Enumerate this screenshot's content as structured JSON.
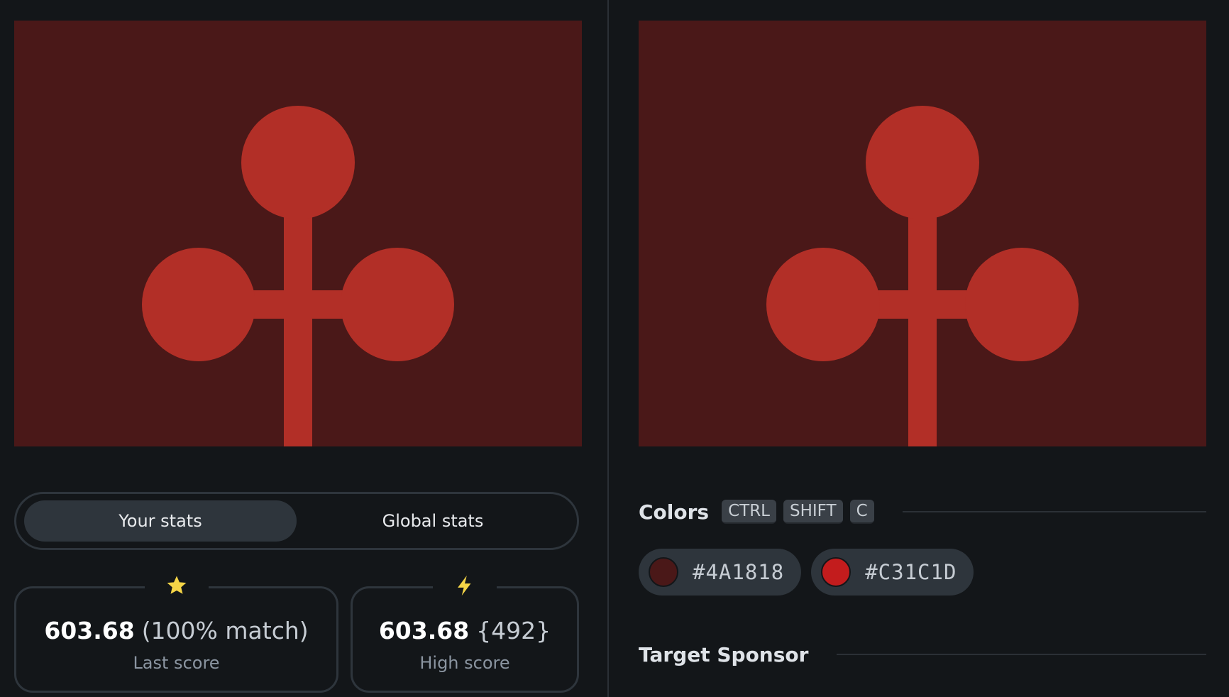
{
  "canvas": {
    "background": "#4A1818",
    "shape_color": "#B22F27"
  },
  "stats": {
    "tabs": [
      {
        "label": "Your stats",
        "active": true
      },
      {
        "label": "Global stats",
        "active": false
      }
    ],
    "last_score": {
      "value": "603.68",
      "extra": "(100% match)",
      "label": "Last score",
      "icon": "star-icon",
      "icon_color": "#F5D547"
    },
    "high_score": {
      "value": "603.68",
      "extra": "{492}",
      "label": "High score",
      "icon": "lightning-icon",
      "icon_color": "#F5D547"
    }
  },
  "colors": {
    "title": "Colors",
    "shortcut": [
      "CTRL",
      "SHIFT",
      "C"
    ],
    "swatches": [
      {
        "hex": "#4A1818"
      },
      {
        "hex": "#C31C1D"
      }
    ]
  },
  "sponsor": {
    "title": "Target Sponsor"
  }
}
